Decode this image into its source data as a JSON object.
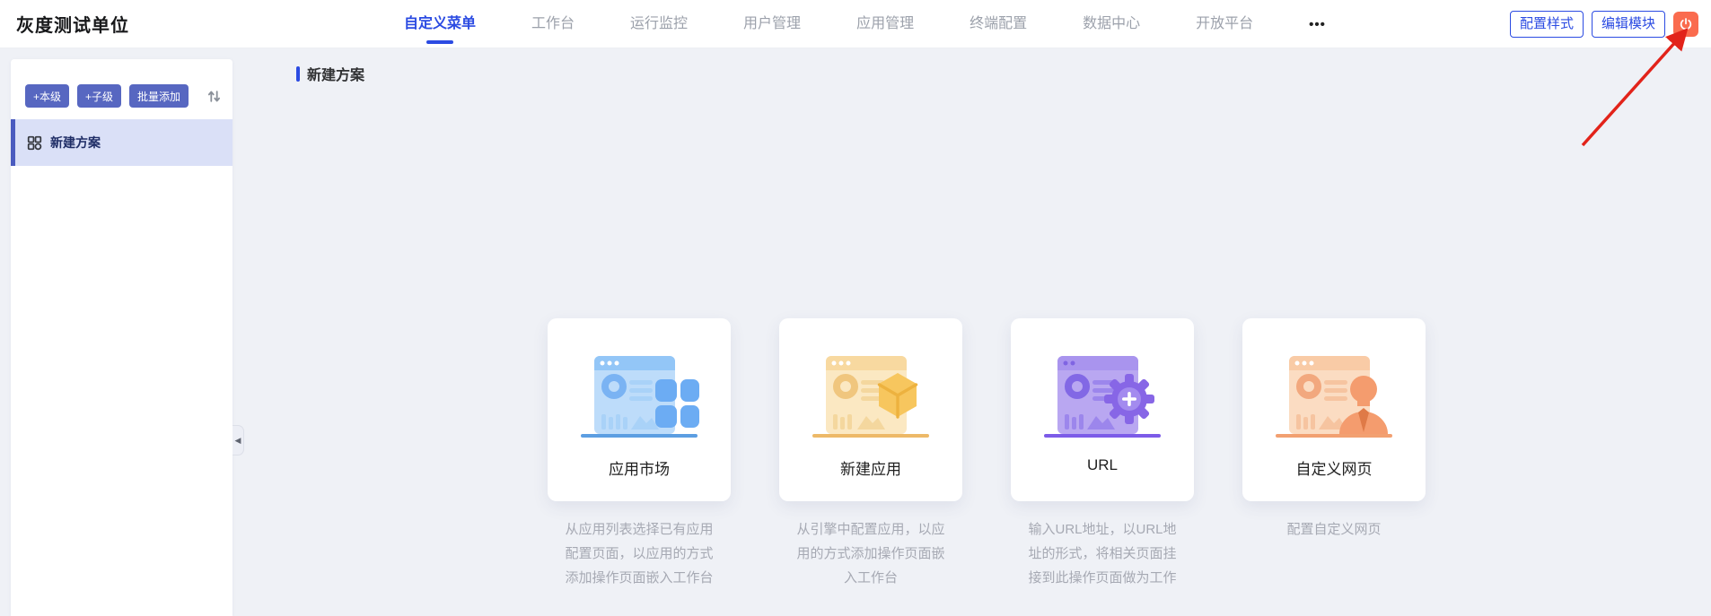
{
  "header": {
    "brand": "灰度测试单位",
    "nav_items": [
      {
        "label": "自定义菜单",
        "active": true
      },
      {
        "label": "工作台",
        "active": false
      },
      {
        "label": "运行监控",
        "active": false
      },
      {
        "label": "用户管理",
        "active": false
      },
      {
        "label": "应用管理",
        "active": false
      },
      {
        "label": "终端配置",
        "active": false
      },
      {
        "label": "数据中心",
        "active": false
      },
      {
        "label": "开放平台",
        "active": false
      }
    ],
    "more_label": "•••",
    "style_button": "配置样式",
    "edit_button": "编辑模块"
  },
  "sidebar": {
    "add_same_level_button": "+本级",
    "add_child_level_button": "+子级",
    "batch_add_button": "批量添加",
    "items": [
      {
        "label": "新建方案",
        "selected": true
      }
    ]
  },
  "main": {
    "section_title": "新建方案",
    "cards": [
      {
        "title": "应用市场",
        "description": "从应用列表选择已有应用配置页面，以应用的方式添加操作页面嵌入工作台",
        "theme": "blue"
      },
      {
        "title": "新建应用",
        "description": "从引擎中配置应用，以应用的方式添加操作页面嵌入工作台",
        "theme": "yellow"
      },
      {
        "title": "URL",
        "description": "输入URL地址，以URL地址的形式，将相关页面挂接到此操作页面做为工作",
        "theme": "purple"
      },
      {
        "title": "自定义网页",
        "description": "配置自定义网页",
        "theme": "orange"
      }
    ]
  },
  "icons": {
    "power": "power-icon",
    "sort": "sort-icon",
    "collapse": "collapse-left-icon",
    "plan_item": "grid-icon",
    "more": "ellipsis-icon"
  },
  "colors": {
    "primary_blue": "#2B4BE2",
    "sidebar_button_blue": "#5767C1",
    "selected_item_bg": "#DAE0F7",
    "power_orange": "#FA6B4E",
    "annotation_red": "#E2231A",
    "page_background": "#EFF1F6",
    "muted_text": "#A6A9B3"
  },
  "collapse_glyph": "◀"
}
